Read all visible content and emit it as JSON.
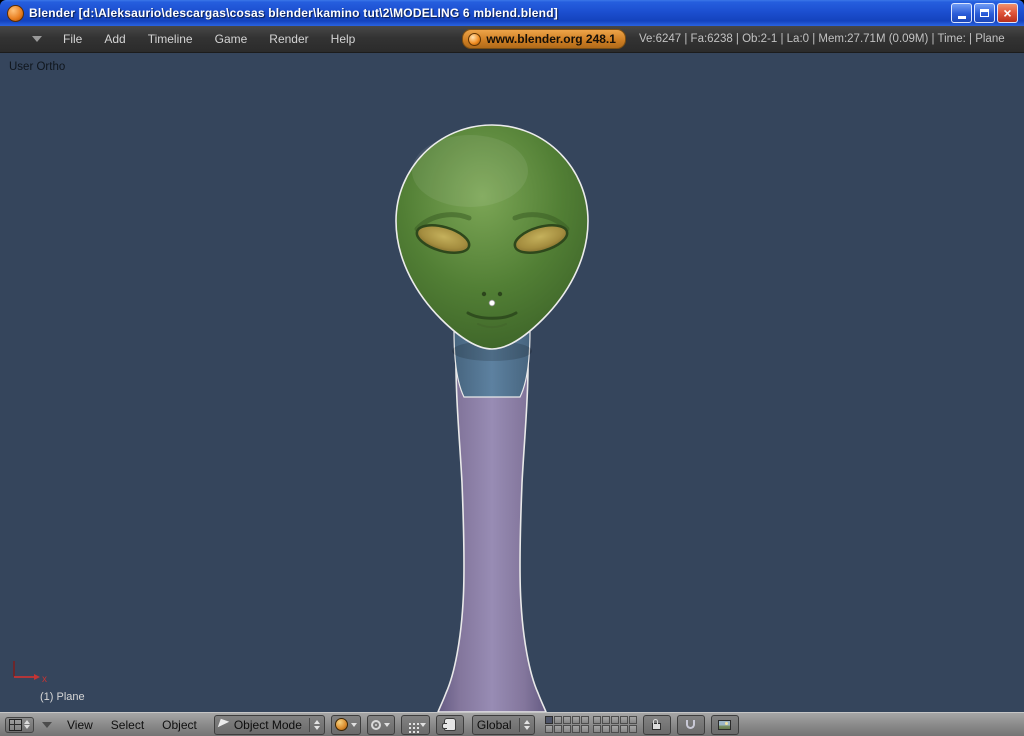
{
  "window": {
    "title": "Blender [d:\\Aleksaurio\\descargas\\cosas blender\\kamino tut\\2\\MODELING 6 mblend.blend]"
  },
  "icons": {
    "close": "×",
    "minimize": "css-bar",
    "maximize": "css-square",
    "collapse_arrow": "css-triangle",
    "editor_grid": "css-grid",
    "shading_ball": "css-ball",
    "pivot": "css-circle-dot",
    "manipulator_dots": "css-dots",
    "hand": "css-hand",
    "lock": "css-lock",
    "magnet": "css-magnet",
    "render_picture": "css-picture"
  },
  "top_header": {
    "menus": [
      "File",
      "Add",
      "Timeline",
      "Game",
      "Render",
      "Help"
    ],
    "badge": "www.blender.org 248.1",
    "stats": "Ve:6247 | Fa:6238 | Ob:2-1 | La:0 | Mem:27.71M (0.09M) | Time: | Plane"
  },
  "viewport": {
    "view_label": "User Ortho",
    "object_label": "(1) Plane",
    "axis_label": "x"
  },
  "bottom_header": {
    "menus": [
      "View",
      "Select",
      "Object"
    ],
    "mode": "Object Mode",
    "orientation": "Global",
    "layer_groups": [
      {
        "count": 10,
        "active": [
          1
        ]
      },
      {
        "count": 10,
        "active": []
      }
    ]
  },
  "colors": {
    "viewport_bg": "#35455c",
    "titlebar_blue": "#1c4fd0",
    "close_red": "#df543a",
    "badge_orange": "#cd7d22",
    "head_green": "#527f35",
    "eye_gold": "#a48d3f",
    "neck_purple": "#988cb4",
    "collar_blue": "#5d81a0",
    "header_gray": "#8b8b8b",
    "top_header_dark": "#333333"
  }
}
